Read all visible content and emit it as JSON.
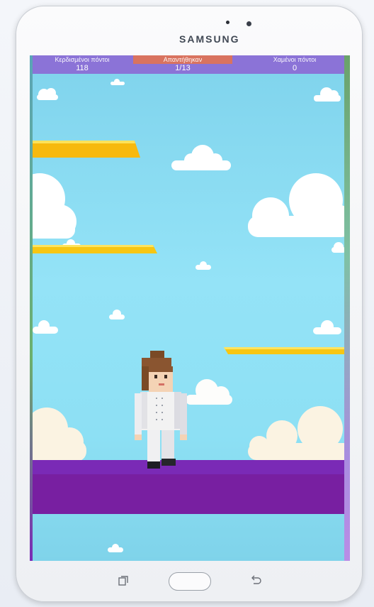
{
  "device": {
    "brand": "SAMSUNG"
  },
  "hud": {
    "earned": {
      "label": "Κερδισμένοι πόντοι",
      "value": "118"
    },
    "answered": {
      "label": "Απαντήθηκαν",
      "value": "1/13"
    },
    "lost": {
      "label": "Χαμένοι πόντοι",
      "value": "0"
    }
  },
  "colors": {
    "hud_bar": "#8b73d7",
    "hud_center": "#d9735f",
    "sky": "#8de0f4",
    "ground": "#781fa1",
    "platform": "#f7c613"
  },
  "icons": {
    "recent_apps": "recent-apps-icon",
    "home": "home-button",
    "back": "back-icon"
  }
}
